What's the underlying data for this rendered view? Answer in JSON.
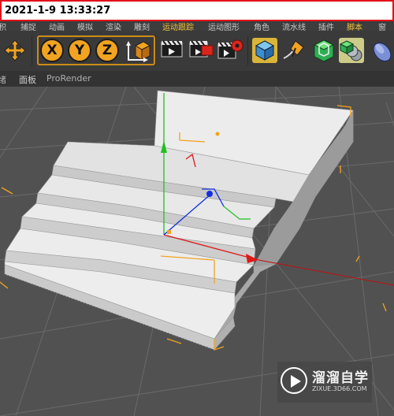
{
  "timestamp": "2021-1-9 13:33:27",
  "menubar": {
    "items": [
      {
        "label": "积",
        "active": false
      },
      {
        "label": "捕捉",
        "active": false
      },
      {
        "label": "动画",
        "active": false
      },
      {
        "label": "模拟",
        "active": false
      },
      {
        "label": "渲染",
        "active": false
      },
      {
        "label": "雕刻",
        "active": false
      },
      {
        "label": "运动跟踪",
        "active": true
      },
      {
        "label": "运动图形",
        "active": false
      },
      {
        "label": "角色",
        "active": false
      },
      {
        "label": "流水线",
        "active": false
      },
      {
        "label": "插件",
        "active": false
      },
      {
        "label": "脚本",
        "active": false
      },
      {
        "label": "窗",
        "active": false
      }
    ]
  },
  "toolbar": {
    "x_label": "X",
    "y_label": "Y",
    "z_label": "Z"
  },
  "tabs": [
    {
      "label": "绪",
      "active": false
    },
    {
      "label": "面板",
      "active": true
    },
    {
      "label": "ProRender",
      "active": false
    }
  ],
  "watermark": {
    "title": "溜溜自学",
    "url": "ZIXUE.3D66.COM"
  },
  "colors": {
    "accent_orange": "#f2a320",
    "highlight_yellow": "#f4c43a",
    "timestamp_border": "#e0101a",
    "axis_x": "#e01818",
    "axis_y": "#20c020",
    "axis_z": "#1030e0"
  },
  "icons": [
    "move-icon",
    "x-axis-icon",
    "y-axis-icon",
    "z-axis-icon",
    "coordinate-system-icon",
    "render-view-icon",
    "render-picture-viewer-icon",
    "render-settings-icon",
    "cube-icon",
    "pen-icon",
    "subdivision-icon",
    "cloner-icon",
    "deformer-icon"
  ]
}
